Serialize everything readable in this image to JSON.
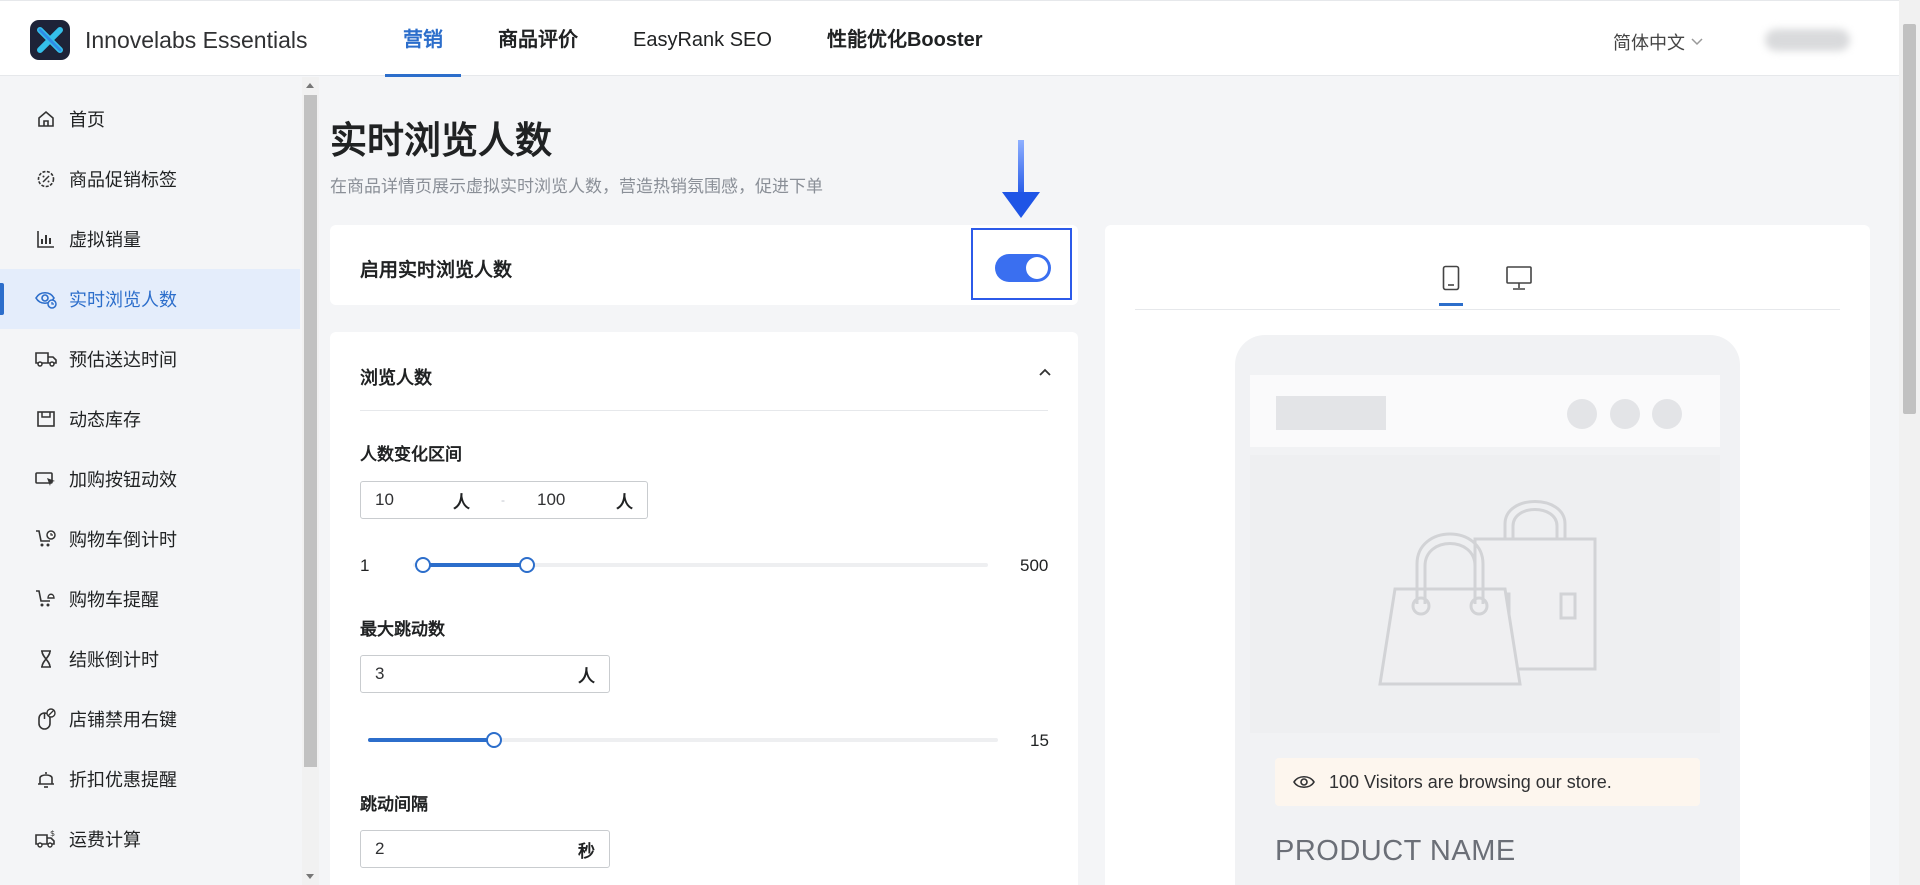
{
  "header": {
    "brand": "Innovelabs Essentials",
    "nav": [
      "营销",
      "商品评价",
      "EasyRank SEO",
      "性能优化Booster"
    ],
    "active_nav": "营销",
    "language": "简体中文"
  },
  "sidebar": {
    "items": [
      {
        "label": "首页",
        "icon": "home-icon"
      },
      {
        "label": "商品促销标签",
        "icon": "badge-icon"
      },
      {
        "label": "虚拟销量",
        "icon": "bar-chart-icon"
      },
      {
        "label": "实时浏览人数",
        "icon": "eye-icon",
        "active": true
      },
      {
        "label": "预估送达时间",
        "icon": "truck-icon"
      },
      {
        "label": "动态库存",
        "icon": "inventory-icon"
      },
      {
        "label": "加购按钮动效",
        "icon": "cursor-icon"
      },
      {
        "label": "购物车倒计时",
        "icon": "cart-clock-icon"
      },
      {
        "label": "购物车提醒",
        "icon": "cart-bell-icon"
      },
      {
        "label": "结账倒计时",
        "icon": "hourglass-icon"
      },
      {
        "label": "店铺禁用右键",
        "icon": "mouse-icon"
      },
      {
        "label": "折扣优惠提醒",
        "icon": "bell-icon"
      },
      {
        "label": "运费计算",
        "icon": "shipping-fee-icon"
      }
    ]
  },
  "page": {
    "title": "实时浏览人数",
    "subtitle": "在商品详情页展示虚拟实时浏览人数，营造热销氛围感，促进下单",
    "enable_label": "启用实时浏览人数",
    "enabled": true
  },
  "settings": {
    "section_title": "浏览人数",
    "range": {
      "label": "人数变化区间",
      "min_value": "10",
      "max_value": "100",
      "unit": "人",
      "separator": "-",
      "slider_min": "1",
      "slider_max": "500",
      "slider_low": 10,
      "slider_high": 100
    },
    "max_jump": {
      "label": "最大跳动数",
      "value": "3",
      "unit": "人",
      "slider_max": "15",
      "slider_value": 3,
      "slider_scale_max": 15
    },
    "interval": {
      "label": "跳动间隔",
      "value": "2",
      "unit": "秒"
    }
  },
  "preview": {
    "visitors_text": "100 Visitors are browsing our store.",
    "product_name": "PRODUCT NAME"
  },
  "colors": {
    "accent": "#2c6ecb",
    "toggle": "#3a6ff0",
    "highlight_box": "#2c5ae9",
    "sidebar_active_bg": "#e4edfb"
  }
}
